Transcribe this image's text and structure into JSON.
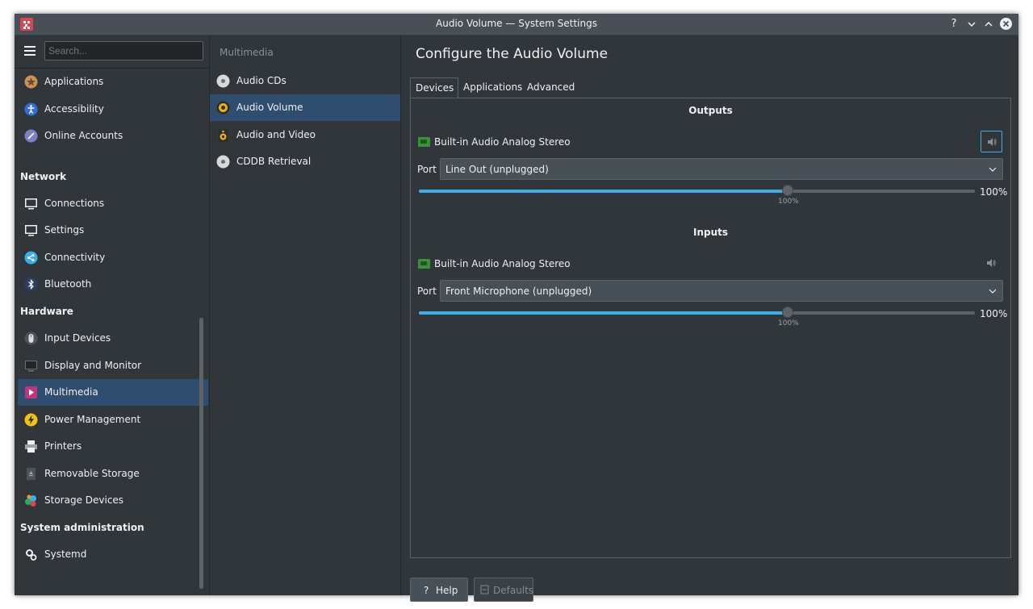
{
  "window": {
    "title": "Audio Volume — System Settings"
  },
  "titlebar": {
    "help": "?",
    "minimize": "⌄",
    "maximize": "⌃",
    "close": "✕"
  },
  "search": {
    "placeholder": "Search..."
  },
  "sidebar": {
    "items_top": [
      {
        "label": "Applications",
        "icon": "applications-icon"
      },
      {
        "label": "Accessibility",
        "icon": "accessibility-icon"
      },
      {
        "label": "Online Accounts",
        "icon": "online-accounts-icon"
      }
    ],
    "network": {
      "heading": "Network",
      "items": [
        {
          "label": "Connections",
          "icon": "connections-icon"
        },
        {
          "label": "Settings",
          "icon": "network-settings-icon"
        },
        {
          "label": "Connectivity",
          "icon": "connectivity-icon"
        },
        {
          "label": "Bluetooth",
          "icon": "bluetooth-icon"
        }
      ]
    },
    "hardware": {
      "heading": "Hardware",
      "items": [
        {
          "label": "Input Devices",
          "icon": "mouse-icon"
        },
        {
          "label": "Display and Monitor",
          "icon": "monitor-icon"
        },
        {
          "label": "Multimedia",
          "icon": "multimedia-icon",
          "selected": true
        },
        {
          "label": "Power Management",
          "icon": "power-icon"
        },
        {
          "label": "Printers",
          "icon": "printer-icon"
        },
        {
          "label": "Removable Storage",
          "icon": "removable-storage-icon"
        },
        {
          "label": "Storage Devices",
          "icon": "storage-devices-icon"
        }
      ]
    },
    "sysadmin": {
      "heading": "System administration",
      "items": [
        {
          "label": "Systemd",
          "icon": "systemd-gear-icon"
        }
      ]
    }
  },
  "subpanel": {
    "title": "Multimedia",
    "items": [
      {
        "label": "Audio CDs",
        "icon": "cd-icon"
      },
      {
        "label": "Audio Volume",
        "icon": "speaker-icon",
        "selected": true
      },
      {
        "label": "Audio and Video",
        "icon": "speaker-icon"
      },
      {
        "label": "CDDB Retrieval",
        "icon": "cd-icon"
      }
    ]
  },
  "main": {
    "title": "Configure the Audio Volume",
    "tabs": [
      {
        "label": "Devices",
        "active": true
      },
      {
        "label": "Applications"
      },
      {
        "label": "Advanced"
      }
    ],
    "outputs": {
      "heading": "Outputs",
      "device": "Built-in Audio Analog Stereo",
      "port_label": "Port",
      "port_value": "Line Out (unplugged)",
      "volume_fraction": 0.663,
      "volume_text": "100%",
      "tick_label": "100%"
    },
    "inputs": {
      "heading": "Inputs",
      "device": "Built-in Audio Analog Stereo",
      "port_label": "Port",
      "port_value": "Front Microphone (unplugged)",
      "volume_fraction": 0.663,
      "volume_text": "100%",
      "tick_label": "100%"
    },
    "buttons": {
      "help": "Help",
      "defaults": "Defaults"
    }
  },
  "colors": {
    "accent": "#3daee9",
    "selection": "#2f4d6e",
    "background": "#31363b"
  }
}
